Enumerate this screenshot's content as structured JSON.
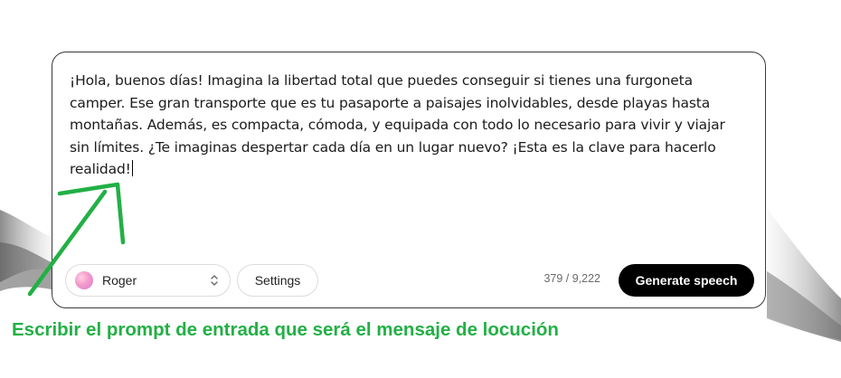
{
  "editor": {
    "prompt_text": "¡Hola, buenos días! Imagina la libertad total que puedes conseguir si tienes una furgoneta camper. Ese gran transporte que es tu pasaporte a paisajes inolvidables, desde playas hasta montañas. Además, es compacta, cómoda, y equipada con todo lo necesario para vivir y viajar sin límites. ¿Te imaginas despertar cada día en un lugar nuevo? ¡Esta es la clave para hacerlo realidad!"
  },
  "toolbar": {
    "voice_name": "Roger",
    "voice_avatar_icon": "gradient-circle-avatar",
    "voice_selector_icon": "chevron-up-down-icon",
    "settings_label": "Settings",
    "char_count": "379 / 9,222",
    "generate_label": "Generate speech"
  },
  "annotation": {
    "caption": "Escribir el prompt de entrada que será el mensaje de locución",
    "color": "#22b045",
    "arrow_icon": "arrow-up-right-icon"
  },
  "colors": {
    "card_border": "#3a3a3a",
    "primary_button": "#000000",
    "annotation_green": "#22b045"
  }
}
